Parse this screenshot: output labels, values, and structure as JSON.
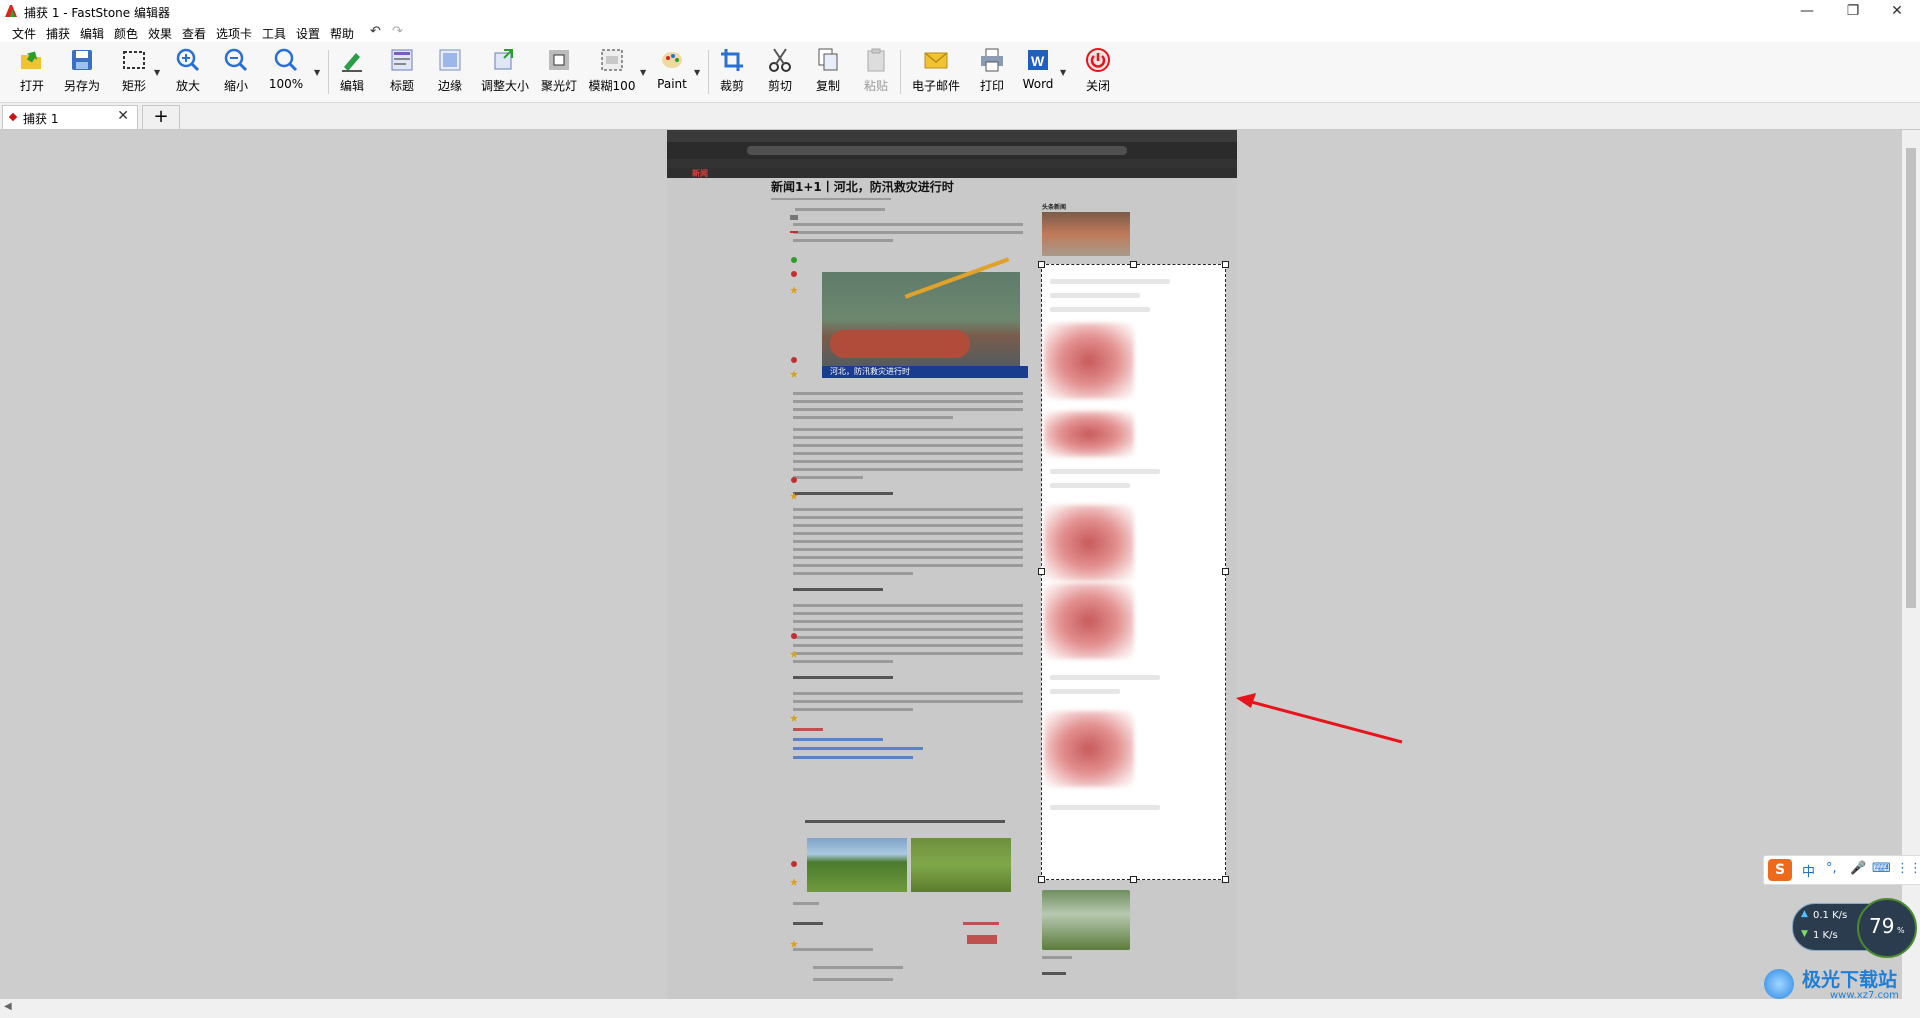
{
  "window": {
    "title": "捕获 1 - FastStone 编辑器",
    "controls": {
      "minimize": "—",
      "maximize": "❐",
      "close": "✕"
    }
  },
  "menu": {
    "items": [
      "文件",
      "捕获",
      "编辑",
      "颜色",
      "效果",
      "查看",
      "选项卡",
      "工具",
      "设置",
      "帮助"
    ],
    "undo_icon": "undo-icon",
    "redo_icon": "redo-icon"
  },
  "toolbar": {
    "buttons": [
      {
        "label": "打开",
        "icon": "open-folder-icon"
      },
      {
        "label": "另存为",
        "icon": "save-icon"
      },
      {
        "label": "矩形",
        "icon": "rectangle-select-icon"
      },
      {
        "label": "放大",
        "icon": "zoom-in-icon"
      },
      {
        "label": "缩小",
        "icon": "zoom-out-icon"
      },
      {
        "label": "100%",
        "icon": "zoom-actual-icon"
      },
      {
        "label": "编辑",
        "icon": "edit-icon"
      },
      {
        "label": "标题",
        "icon": "caption-icon"
      },
      {
        "label": "边缘",
        "icon": "edge-icon"
      },
      {
        "label": "调整大小",
        "icon": "resize-icon"
      },
      {
        "label": "聚光灯",
        "icon": "spotlight-icon"
      },
      {
        "label": "模糊100",
        "icon": "blur-icon"
      },
      {
        "label": "Paint",
        "icon": "paint-icon"
      },
      {
        "label": "裁剪",
        "icon": "crop-icon"
      },
      {
        "label": "剪切",
        "icon": "cut-icon"
      },
      {
        "label": "复制",
        "icon": "copy-icon"
      },
      {
        "label": "粘贴",
        "icon": "paste-icon",
        "disabled": true
      },
      {
        "label": "电子邮件",
        "icon": "email-icon"
      },
      {
        "label": "打印",
        "icon": "print-icon"
      },
      {
        "label": "Word",
        "icon": "word-icon"
      },
      {
        "label": "关闭",
        "icon": "power-icon"
      }
    ]
  },
  "tabs": {
    "items": [
      {
        "label": "捕获 1",
        "close": "✕"
      }
    ],
    "new_tab": "+"
  },
  "capture": {
    "site_logo": "新闻",
    "article_title": "新闻1+1丨河北，防汛救灾进行时",
    "photo_caption": "河北，防汛救灾进行时",
    "side_heading": "头条新闻"
  },
  "ime": {
    "logo": "S",
    "items": [
      "中",
      "°,",
      "🎤",
      "⌨",
      "⋮⋮"
    ]
  },
  "network": {
    "upload": "0.1 K/s",
    "download": "1 K/s",
    "percent": "79",
    "percent_unit": "%"
  },
  "watermark": {
    "text": "极光下载站",
    "url": "www.xz7.com"
  },
  "colors": {
    "accent_red": "#e8141c",
    "selection_border": "#222222",
    "canvas_bg": "#cdcdcd"
  }
}
